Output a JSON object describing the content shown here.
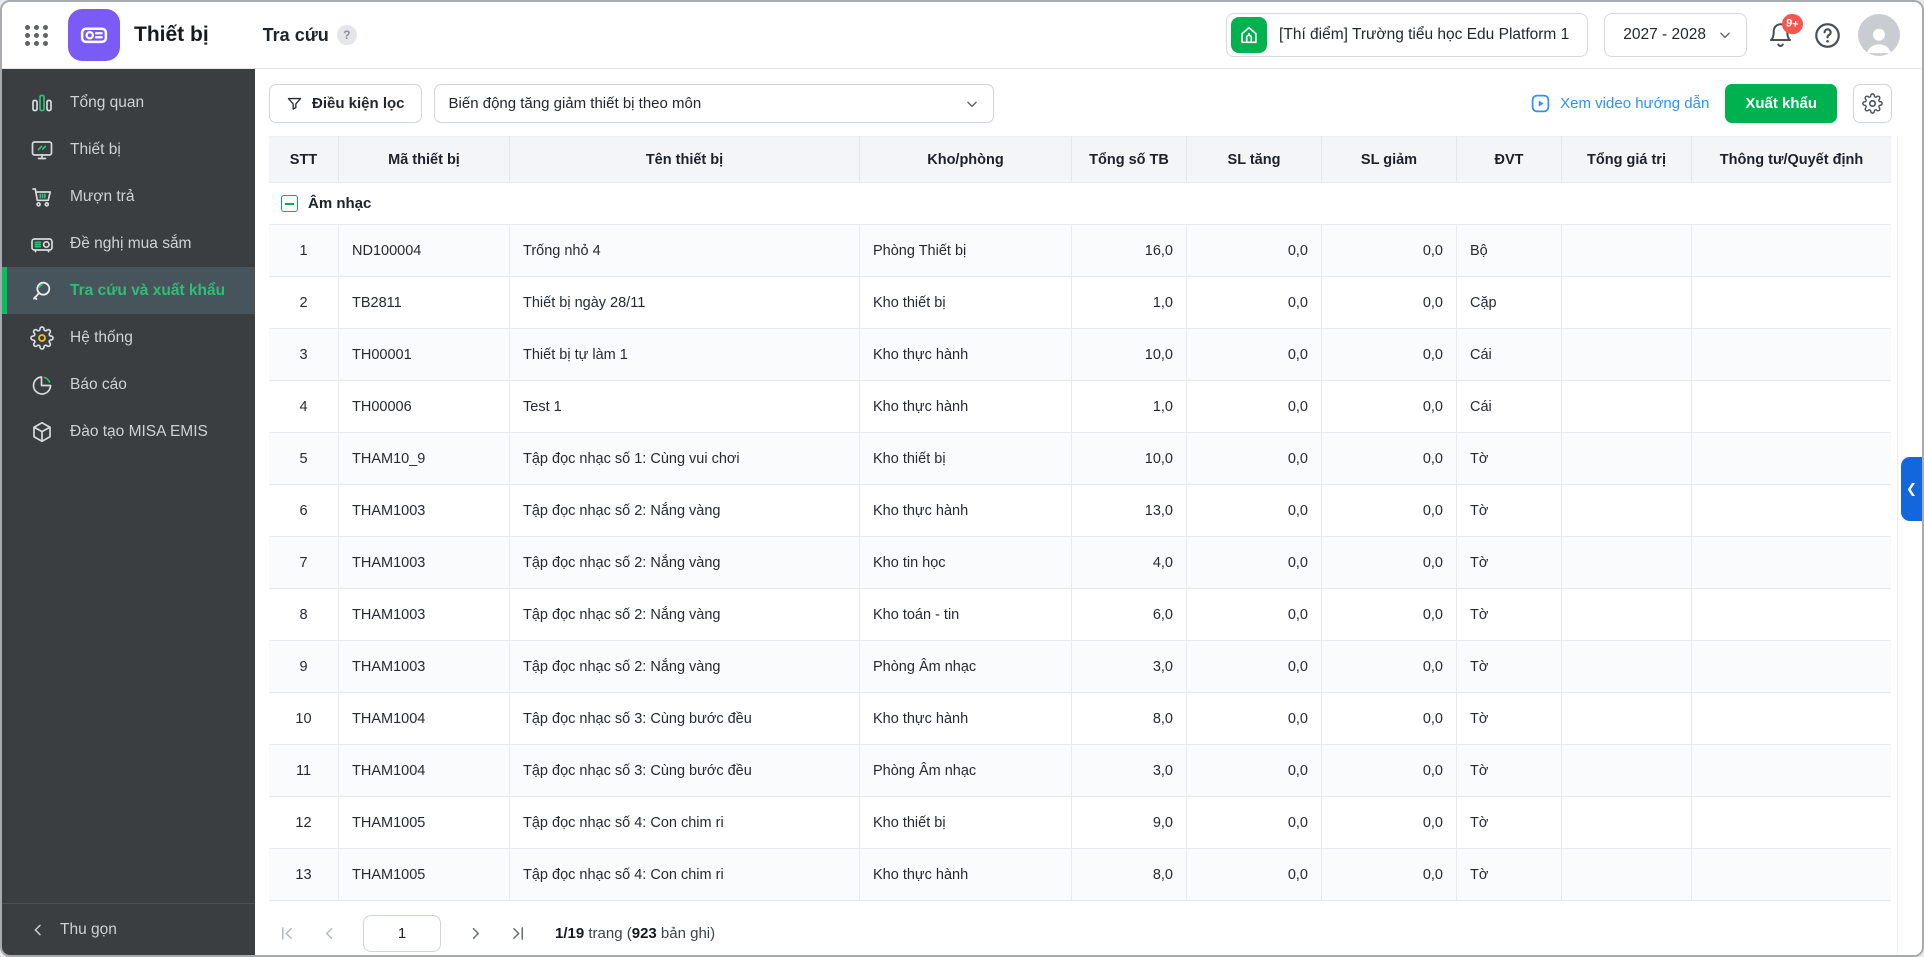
{
  "header": {
    "app_title": "Thiết bị",
    "page_title": "Tra cứu",
    "help_badge": "?",
    "school_name": "[Thí điểm] Trường tiểu học Edu Platform 1",
    "school_year": "2027 - 2028",
    "notification_count": "9+"
  },
  "sidebar": {
    "items": [
      {
        "label": "Tổng quan",
        "icon": "chart-bars",
        "active": false
      },
      {
        "label": "Thiết bị",
        "icon": "monitor",
        "active": false
      },
      {
        "label": "Mượn trả",
        "icon": "cart",
        "active": false
      },
      {
        "label": "Đề nghị mua sắm",
        "icon": "projector",
        "active": false
      },
      {
        "label": "Tra cứu và xuất khẩu",
        "icon": "search",
        "active": true
      },
      {
        "label": "Hệ thống",
        "icon": "gear",
        "active": false
      },
      {
        "label": "Báo cáo",
        "icon": "pie",
        "active": false
      },
      {
        "label": "Đào tạo MISA EMIS",
        "icon": "cube",
        "active": false
      }
    ],
    "collapse_label": "Thu gọn"
  },
  "toolbar": {
    "filter_label": "Điều kiện lọc",
    "report_select_value": "Biến động tăng giảm thiết bị theo môn",
    "video_link_label": "Xem video hướng dẫn",
    "export_label": "Xuất khẩu"
  },
  "table": {
    "columns": [
      "STT",
      "Mã thiết bị",
      "Tên thiết bị",
      "Kho/phòng",
      "Tổng số TB",
      "SL tăng",
      "SL giảm",
      "ĐVT",
      "Tổng giá trị",
      "Thông tư/Quyết định"
    ],
    "group_label": "Âm nhạc",
    "rows": [
      [
        "1",
        "ND100004",
        "Trống nhỏ 4",
        "Phòng Thiết bị",
        "16,0",
        "0,0",
        "0,0",
        "Bộ",
        "",
        ""
      ],
      [
        "2",
        "TB2811",
        "Thiết bị ngày 28/11",
        "Kho thiết bị",
        "1,0",
        "0,0",
        "0,0",
        "Cặp",
        "",
        ""
      ],
      [
        "3",
        "TH00001",
        "Thiết bị tự làm 1",
        "Kho thực hành",
        "10,0",
        "0,0",
        "0,0",
        "Cái",
        "",
        ""
      ],
      [
        "4",
        "TH00006",
        "Test 1",
        "Kho thực hành",
        "1,0",
        "0,0",
        "0,0",
        "Cái",
        "",
        ""
      ],
      [
        "5",
        "THAM10_9",
        "Tập đọc nhạc số 1: Cùng vui chơi",
        "Kho thiết bị",
        "10,0",
        "0,0",
        "0,0",
        "Tờ",
        "",
        ""
      ],
      [
        "6",
        "THAM1003",
        "Tập đọc nhạc số 2: Nắng vàng",
        "Kho thực hành",
        "13,0",
        "0,0",
        "0,0",
        "Tờ",
        "",
        ""
      ],
      [
        "7",
        "THAM1003",
        "Tập đọc nhạc số 2: Nắng vàng",
        "Kho tin học",
        "4,0",
        "0,0",
        "0,0",
        "Tờ",
        "",
        ""
      ],
      [
        "8",
        "THAM1003",
        "Tập đọc nhạc số 2: Nắng vàng",
        "Kho toán - tin",
        "6,0",
        "0,0",
        "0,0",
        "Tờ",
        "",
        ""
      ],
      [
        "9",
        "THAM1003",
        "Tập đọc nhạc số 2: Nắng vàng",
        "Phòng Âm nhạc",
        "3,0",
        "0,0",
        "0,0",
        "Tờ",
        "",
        ""
      ],
      [
        "10",
        "THAM1004",
        "Tập đọc nhạc số 3: Cùng bước đều",
        "Kho thực hành",
        "8,0",
        "0,0",
        "0,0",
        "Tờ",
        "",
        ""
      ],
      [
        "11",
        "THAM1004",
        "Tập đọc nhạc số 3: Cùng bước đều",
        "Phòng Âm nhạc",
        "3,0",
        "0,0",
        "0,0",
        "Tờ",
        "",
        ""
      ],
      [
        "12",
        "THAM1005",
        "Tập đọc nhạc số 4: Con chim ri",
        "Kho thiết bị",
        "9,0",
        "0,0",
        "0,0",
        "Tờ",
        "",
        ""
      ],
      [
        "13",
        "THAM1005",
        "Tập đọc nhạc số 4: Con chim ri",
        "Kho thực hành",
        "8,0",
        "0,0",
        "0,0",
        "Tờ",
        "",
        ""
      ]
    ]
  },
  "pagination": {
    "page_input_value": "1",
    "pages_bold": "1/19",
    "middle_text": " trang (",
    "records_bold": "923",
    "end_text": " bản ghi)"
  },
  "colors": {
    "primary_green": "#00b14f",
    "active_green_text": "#2fbe76",
    "link_blue": "#2e90fa",
    "handle_blue": "#1466dc",
    "badge_red": "#f5564e",
    "sidebar_bg": "#3a3e40",
    "sidebar_active_bg": "#48545c",
    "app_icon_purple": "#7b5bf5",
    "gear_accent_yellow": "#f0c11c"
  }
}
